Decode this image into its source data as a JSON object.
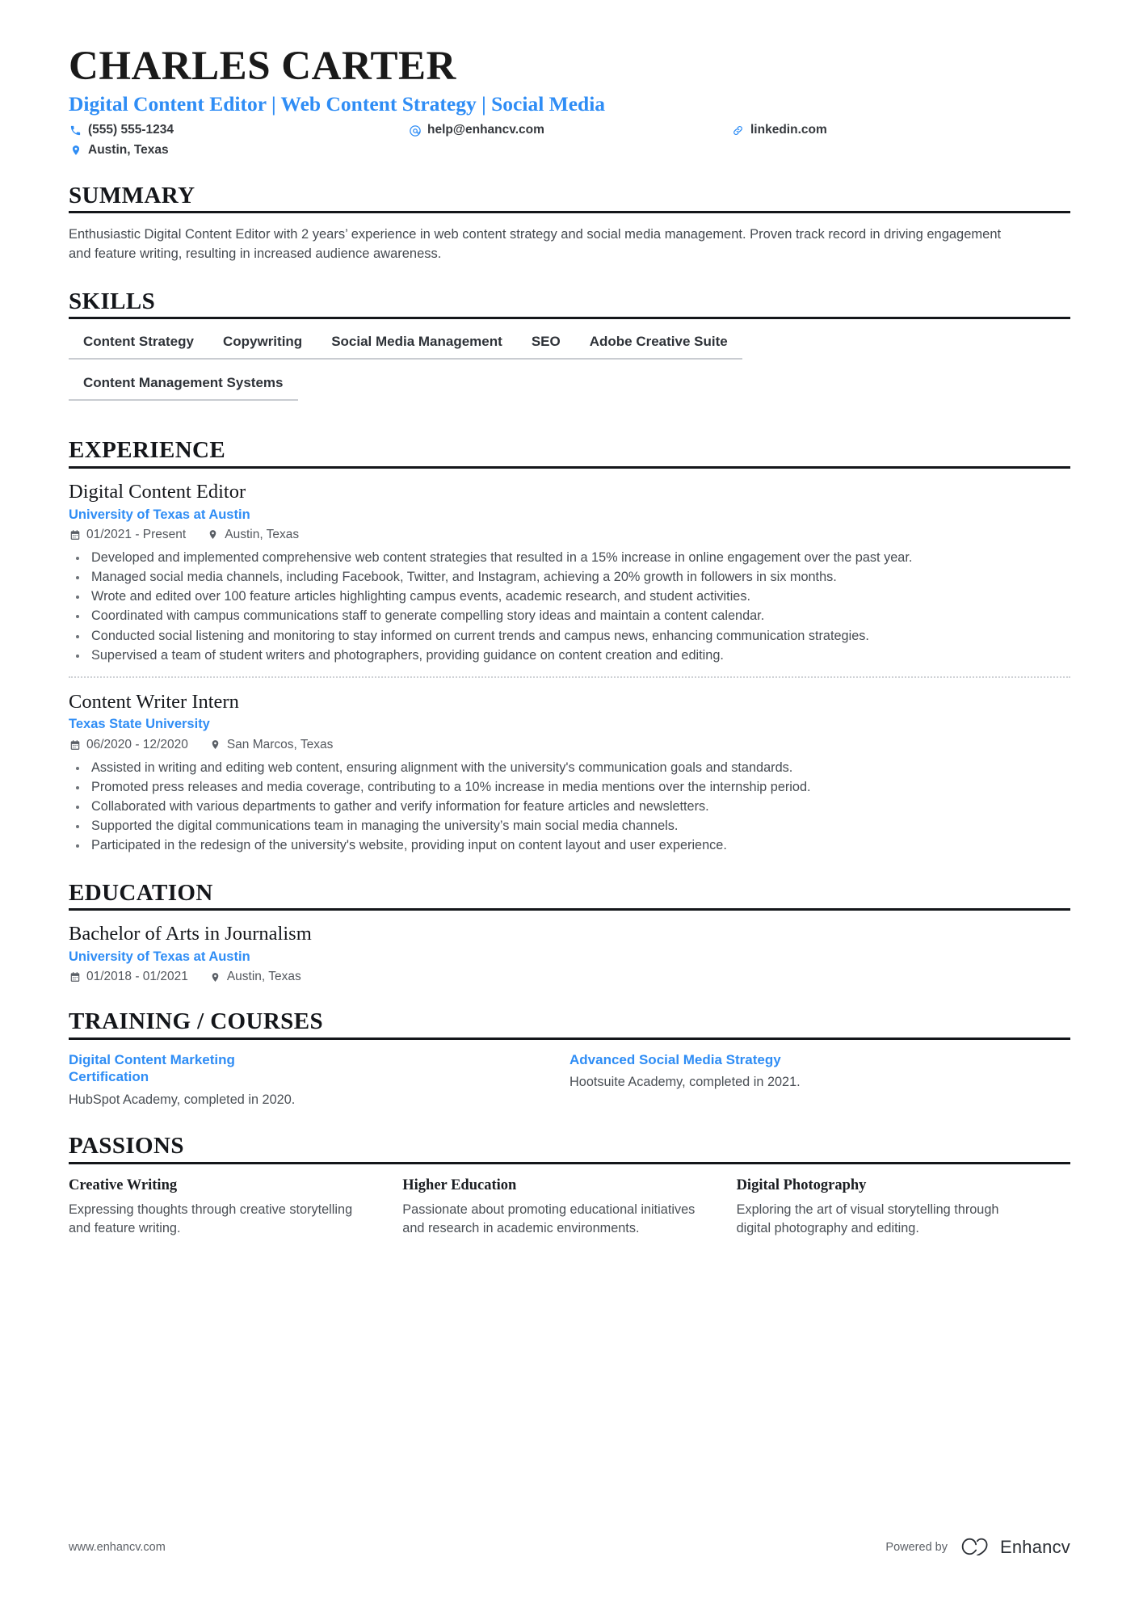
{
  "header": {
    "name": "CHARLES CARTER",
    "headline": "Digital Content Editor | Web Content Strategy | Social Media",
    "contacts": [
      {
        "icon": "phone-icon",
        "text": "(555) 555-1234"
      },
      {
        "icon": "email-icon",
        "text": "help@enhancv.com"
      },
      {
        "icon": "link-icon",
        "text": "linkedin.com"
      },
      {
        "icon": "location-icon",
        "text": "Austin, Texas"
      }
    ]
  },
  "summary": {
    "title": "SUMMARY",
    "text": "Enthusiastic Digital Content Editor with 2 years’ experience in web content strategy and social media management. Proven track record in driving engagement and feature writing, resulting in increased audience awareness."
  },
  "skills": {
    "title": "SKILLS",
    "items": [
      "Content Strategy",
      "Copywriting",
      "Social Media Management",
      "SEO",
      "Adobe Creative Suite",
      "Content Management Systems"
    ]
  },
  "experience": {
    "title": "EXPERIENCE",
    "entries": [
      {
        "role": "Digital Content Editor",
        "org": "University of Texas at Austin",
        "dates": "01/2021 - Present",
        "location": "Austin, Texas",
        "bullets": [
          "Developed and implemented comprehensive web content strategies that resulted in a 15% increase in online engagement over the past year.",
          "Managed social media channels, including Facebook, Twitter, and Instagram, achieving a 20% growth in followers in six months.",
          "Wrote and edited over 100 feature articles highlighting campus events, academic research, and student activities.",
          "Coordinated with campus communications staff to generate compelling story ideas and maintain a content calendar.",
          "Conducted social listening and monitoring to stay informed on current trends and campus news, enhancing communication strategies.",
          "Supervised a team of student writers and photographers, providing guidance on content creation and editing."
        ]
      },
      {
        "role": "Content Writer Intern",
        "org": "Texas State University",
        "dates": "06/2020 - 12/2020",
        "location": "San Marcos, Texas",
        "bullets": [
          "Assisted in writing and editing web content, ensuring alignment with the university's communication goals and standards.",
          "Promoted press releases and media coverage, contributing to a 10% increase in media mentions over the internship period.",
          "Collaborated with various departments to gather and verify information for feature articles and newsletters.",
          "Supported the digital communications team in managing the university’s main social media channels.",
          "Participated in the redesign of the university's website, providing input on content layout and user experience."
        ]
      }
    ]
  },
  "education": {
    "title": "EDUCATION",
    "entries": [
      {
        "degree": "Bachelor of Arts in Journalism",
        "org": "University of Texas at Austin",
        "dates": "01/2018 - 01/2021",
        "location": "Austin, Texas"
      }
    ]
  },
  "training": {
    "title": "TRAINING / COURSES",
    "courses": [
      {
        "name": "Digital Content Marketing Certification",
        "desc": "HubSpot Academy, completed in 2020."
      },
      {
        "name": "Advanced Social Media Strategy",
        "desc": "Hootsuite Academy, completed in 2021."
      }
    ]
  },
  "passions": {
    "title": "PASSIONS",
    "items": [
      {
        "name": "Creative Writing",
        "desc": "Expressing thoughts through creative storytelling and feature writing."
      },
      {
        "name": "Higher Education",
        "desc": "Passionate about promoting educational initiatives and research in academic environments."
      },
      {
        "name": "Digital Photography",
        "desc": "Exploring the art of visual storytelling through digital photography and editing."
      }
    ]
  },
  "footer": {
    "url": "www.enhancv.com",
    "powered_by": "Powered by",
    "brand": "Enhancv"
  },
  "colors": {
    "accent": "#2f8df5",
    "text": "#454a50",
    "heading": "#14161a",
    "rule": "#c9ccd1"
  }
}
